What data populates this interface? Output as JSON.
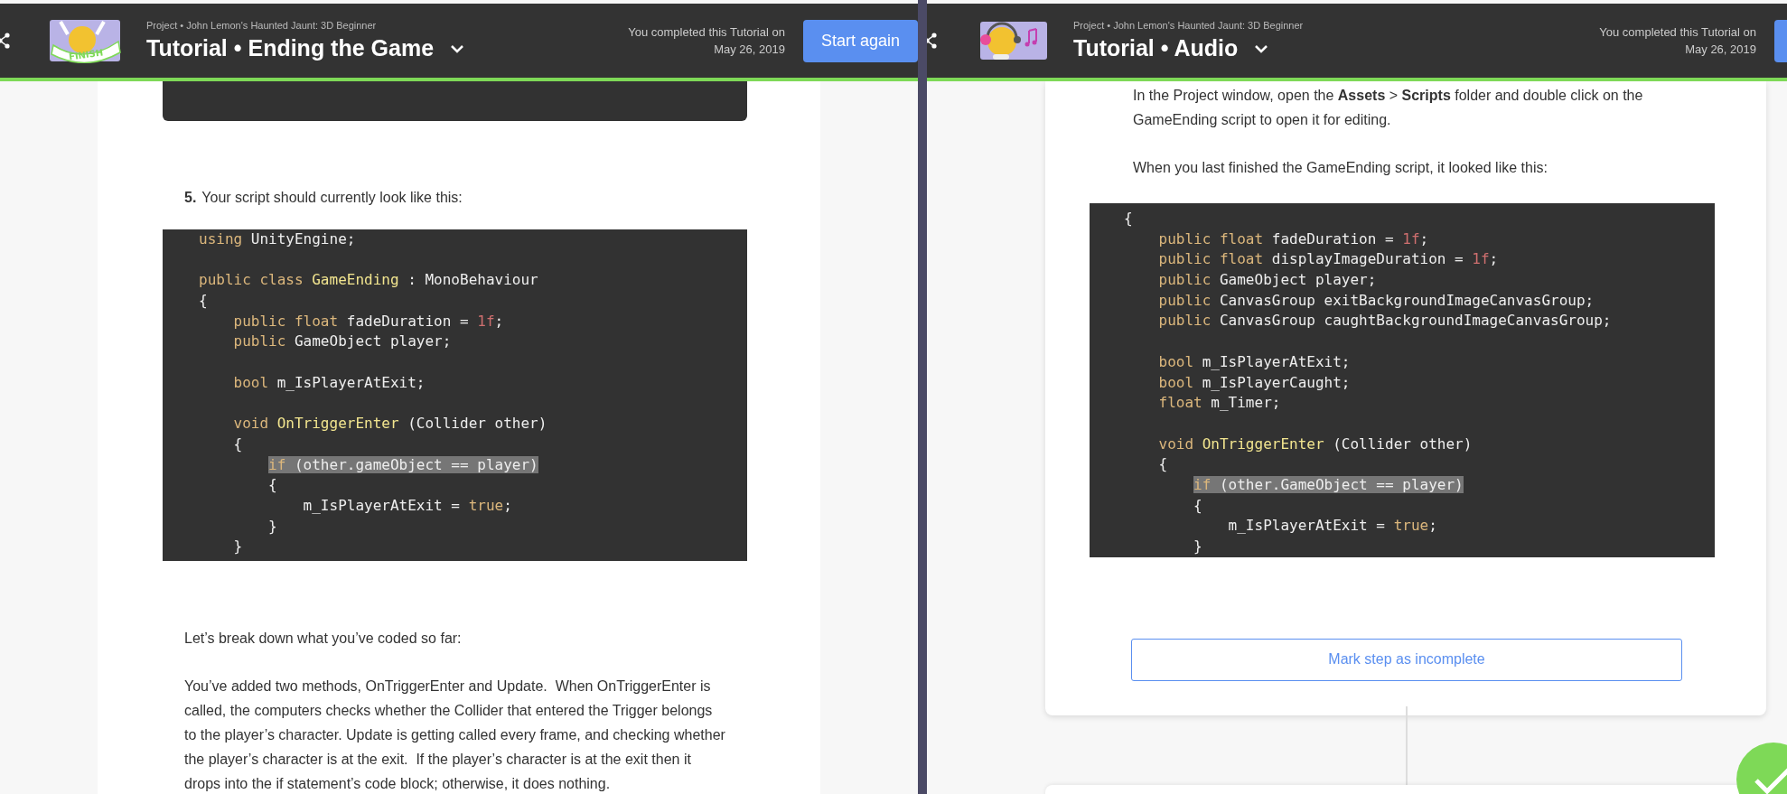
{
  "panes": [
    {
      "header": {
        "project": "Project • John Lemon's Haunted Jaunt: 3D Beginner",
        "title": "Tutorial • Ending the Game",
        "badge": {
          "kind": "finish",
          "text": "FINISH"
        },
        "completed": [
          "You completed this Tutorial on",
          "May 26, 2019"
        ],
        "button": "Start again"
      },
      "blocks": [
        {
          "kind": "code_stub"
        },
        {
          "kind": "step",
          "number": "5.",
          "text": "Your script should currently look like this:"
        },
        {
          "kind": "code",
          "lines": [
            {
              "kind": "code",
              "highlighted": false,
              "tokens": [
                {
                  "kind": "keyword",
                  "text": "using"
                },
                {
                  "kind": "plain",
                  "text": " UnityEngine;"
                }
              ]
            },
            {
              "kind": "blank"
            },
            {
              "kind": "code",
              "highlighted": false,
              "tokens": [
                {
                  "kind": "keyword",
                  "text": "public class "
                },
                {
                  "kind": "name",
                  "text": "GameEnding"
                },
                {
                  "kind": "plain",
                  "text": " : MonoBehaviour"
                }
              ]
            },
            {
              "kind": "code",
              "highlighted": false,
              "tokens": [
                {
                  "kind": "plain",
                  "text": "{"
                }
              ]
            },
            {
              "kind": "code",
              "highlighted": false,
              "tokens": [
                {
                  "kind": "keyword",
                  "text": "    public float"
                },
                {
                  "kind": "plain",
                  "text": " fadeDuration = "
                },
                {
                  "kind": "number",
                  "text": "1f"
                },
                {
                  "kind": "plain",
                  "text": ";"
                }
              ]
            },
            {
              "kind": "code",
              "highlighted": false,
              "tokens": [
                {
                  "kind": "keyword",
                  "text": "    public"
                },
                {
                  "kind": "plain",
                  "text": " GameObject player;"
                }
              ]
            },
            {
              "kind": "blank"
            },
            {
              "kind": "code",
              "highlighted": false,
              "tokens": [
                {
                  "kind": "keyword",
                  "text": "    bool"
                },
                {
                  "kind": "plain",
                  "text": " m_IsPlayerAtExit;"
                }
              ]
            },
            {
              "kind": "blank"
            },
            {
              "kind": "code",
              "highlighted": false,
              "tokens": [
                {
                  "kind": "keyword",
                  "text": "    void "
                },
                {
                  "kind": "name",
                  "text": "OnTriggerEnter"
                },
                {
                  "kind": "plain",
                  "text": " (Collider other)"
                }
              ]
            },
            {
              "kind": "code",
              "highlighted": false,
              "tokens": [
                {
                  "kind": "plain",
                  "text": "    {"
                }
              ]
            },
            {
              "kind": "code",
              "highlighted": true,
              "tokens": [
                {
                  "kind": "keyword",
                  "text": "        if"
                },
                {
                  "kind": "plain",
                  "text": " (other.gameObject == player)"
                }
              ]
            },
            {
              "kind": "code",
              "highlighted": false,
              "tokens": [
                {
                  "kind": "plain",
                  "text": "        {"
                }
              ]
            },
            {
              "kind": "code",
              "highlighted": false,
              "tokens": [
                {
                  "kind": "plain",
                  "text": "            m_IsPlayerAtExit = "
                },
                {
                  "kind": "keyword",
                  "text": "true"
                },
                {
                  "kind": "plain",
                  "text": ";"
                }
              ]
            },
            {
              "kind": "code",
              "highlighted": false,
              "tokens": [
                {
                  "kind": "plain",
                  "text": "        }"
                }
              ]
            },
            {
              "kind": "code",
              "highlighted": false,
              "tokens": [
                {
                  "kind": "plain",
                  "text": "    }"
                }
              ]
            }
          ]
        },
        {
          "kind": "paragraph",
          "text": "Let’s break down what you’ve coded so far:"
        },
        {
          "kind": "paragraph",
          "text": "You’ve added two methods, OnTriggerEnter and Update.  When OnTriggerEnter is called, the computers checks whether the Collider that entered the Trigger belongs to the player’s character. Update is getting called every frame, and checking whether the player’s character is at the exit.  If the player’s character is at the exit then it drops into the if statement’s code block; otherwise, it does nothing."
        }
      ]
    },
    {
      "header": {
        "project": "Project • John Lemon's Haunted Jaunt: 3D Beginner",
        "title": "Tutorial • Audio",
        "badge": {
          "kind": "music"
        },
        "completed": [
          "You completed this Tutorial on",
          "May 26, 2019"
        ]
      },
      "blocks": [
        {
          "kind": "paragraph",
          "text": "In the Project window, open the **Assets** > **Scripts** folder and double click on the GameEnding script to open it for editing."
        },
        {
          "kind": "paragraph",
          "text": "When you last finished the GameEnding script, it looked like this:"
        },
        {
          "kind": "code",
          "lines": [
            {
              "kind": "code",
              "highlighted": false,
              "tokens": [
                {
                  "kind": "plain",
                  "text": "{"
                }
              ]
            },
            {
              "kind": "code",
              "highlighted": false,
              "tokens": [
                {
                  "kind": "keyword",
                  "text": "    public float"
                },
                {
                  "kind": "plain",
                  "text": " fadeDuration = "
                },
                {
                  "kind": "number",
                  "text": "1f"
                },
                {
                  "kind": "plain",
                  "text": ";"
                }
              ]
            },
            {
              "kind": "code",
              "highlighted": false,
              "tokens": [
                {
                  "kind": "keyword",
                  "text": "    public float"
                },
                {
                  "kind": "plain",
                  "text": " displayImageDuration = "
                },
                {
                  "kind": "number",
                  "text": "1f"
                },
                {
                  "kind": "plain",
                  "text": ";"
                }
              ]
            },
            {
              "kind": "code",
              "highlighted": false,
              "tokens": [
                {
                  "kind": "keyword",
                  "text": "    public"
                },
                {
                  "kind": "plain",
                  "text": " GameObject player;"
                }
              ]
            },
            {
              "kind": "code",
              "highlighted": false,
              "tokens": [
                {
                  "kind": "keyword",
                  "text": "    public"
                },
                {
                  "kind": "plain",
                  "text": " CanvasGroup exitBackgroundImageCanvasGroup;"
                }
              ]
            },
            {
              "kind": "code",
              "highlighted": false,
              "tokens": [
                {
                  "kind": "keyword",
                  "text": "    public"
                },
                {
                  "kind": "plain",
                  "text": " CanvasGroup caughtBackgroundImageCanvasGroup;"
                }
              ]
            },
            {
              "kind": "blank"
            },
            {
              "kind": "code",
              "highlighted": false,
              "tokens": [
                {
                  "kind": "keyword",
                  "text": "    bool"
                },
                {
                  "kind": "plain",
                  "text": " m_IsPlayerAtExit;"
                }
              ]
            },
            {
              "kind": "code",
              "highlighted": false,
              "tokens": [
                {
                  "kind": "keyword",
                  "text": "    bool"
                },
                {
                  "kind": "plain",
                  "text": " m_IsPlayerCaught;"
                }
              ]
            },
            {
              "kind": "code",
              "highlighted": false,
              "tokens": [
                {
                  "kind": "keyword",
                  "text": "    float"
                },
                {
                  "kind": "plain",
                  "text": " m_Timer;"
                }
              ]
            },
            {
              "kind": "blank"
            },
            {
              "kind": "code",
              "highlighted": false,
              "tokens": [
                {
                  "kind": "keyword",
                  "text": "    void "
                },
                {
                  "kind": "name",
                  "text": "OnTriggerEnter"
                },
                {
                  "kind": "plain",
                  "text": " (Collider other)"
                }
              ]
            },
            {
              "kind": "code",
              "highlighted": false,
              "tokens": [
                {
                  "kind": "plain",
                  "text": "    {"
                }
              ]
            },
            {
              "kind": "code",
              "highlighted": true,
              "tokens": [
                {
                  "kind": "keyword",
                  "text": "        if"
                },
                {
                  "kind": "plain",
                  "text": " (other.GameObject == player)"
                }
              ]
            },
            {
              "kind": "code",
              "highlighted": false,
              "tokens": [
                {
                  "kind": "plain",
                  "text": "        {"
                }
              ]
            },
            {
              "kind": "code",
              "highlighted": false,
              "tokens": [
                {
                  "kind": "plain",
                  "text": "            m_IsPlayerAtExit = "
                },
                {
                  "kind": "keyword",
                  "text": "true"
                },
                {
                  "kind": "plain",
                  "text": ";"
                }
              ]
            },
            {
              "kind": "code",
              "highlighted": false,
              "tokens": [
                {
                  "kind": "plain",
                  "text": "        }"
                }
              ]
            }
          ]
        },
        {
          "kind": "button",
          "text": "Mark step as incomplete"
        }
      ]
    }
  ]
}
